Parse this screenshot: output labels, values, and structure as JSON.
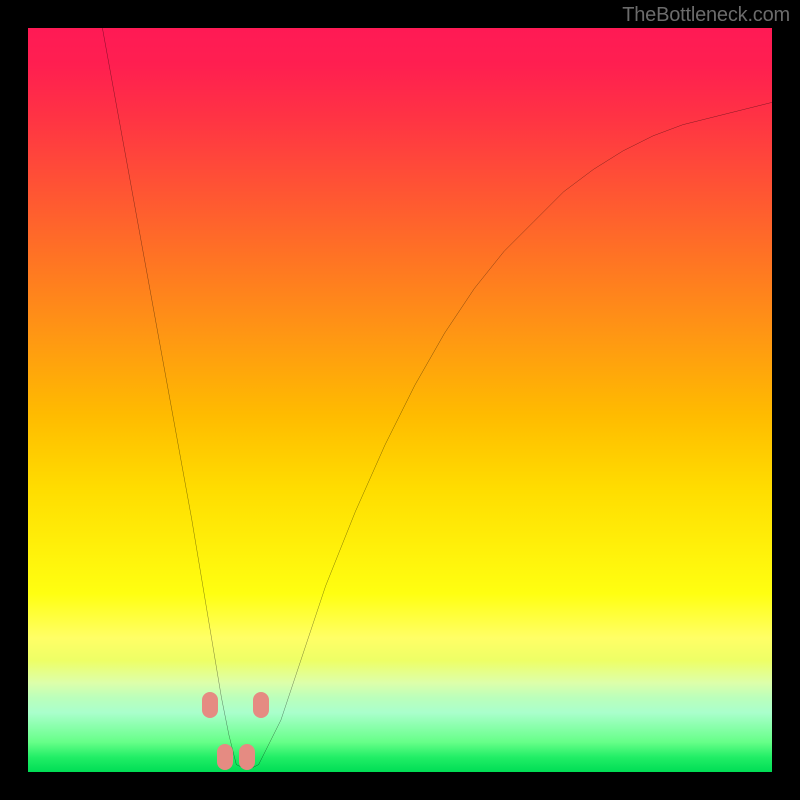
{
  "watermark": "TheBottleneck.com",
  "chart_data": {
    "type": "line",
    "title": "",
    "xlabel": "",
    "ylabel": "",
    "xlim": [
      0,
      100
    ],
    "ylim": [
      0,
      100
    ],
    "grid": false,
    "description": "V-shaped bottleneck curve overlaid on vertical red-to-green gradient; minimum near x≈28 at y≈0.",
    "series": [
      {
        "name": "bottleneck-curve",
        "color": "#000000",
        "x": [
          10,
          12,
          14,
          16,
          18,
          20,
          22,
          24,
          25,
          26,
          27,
          28,
          29,
          30,
          31,
          32,
          34,
          36,
          38,
          40,
          44,
          48,
          52,
          56,
          60,
          64,
          68,
          72,
          76,
          80,
          84,
          88,
          92,
          96,
          100
        ],
        "y": [
          100,
          89,
          78,
          67,
          56,
          45,
          34,
          22,
          16,
          10,
          5,
          1,
          0.5,
          0.5,
          1,
          3,
          7,
          13,
          19,
          25,
          35,
          44,
          52,
          59,
          65,
          70,
          74,
          78,
          81,
          83.5,
          85.5,
          87,
          88,
          89,
          90
        ]
      }
    ],
    "markers": [
      {
        "x": 24.5,
        "y": 9
      },
      {
        "x": 26.5,
        "y": 2
      },
      {
        "x": 29.5,
        "y": 2
      },
      {
        "x": 31.3,
        "y": 9
      }
    ],
    "marker_style": {
      "color": "#e58b82",
      "shape": "rounded-pill"
    }
  }
}
